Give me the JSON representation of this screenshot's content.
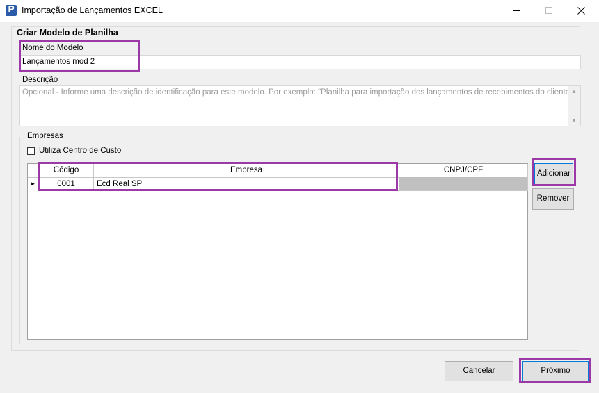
{
  "window": {
    "title": "Importação de Lançamentos EXCEL",
    "icon_letter": "P",
    "minimize_icon": "minimize-icon",
    "maximize_icon": "maximize-icon",
    "close_icon": "close-icon"
  },
  "form": {
    "section_title": "Criar Modelo de Planilha",
    "model_name_label": "Nome do Modelo",
    "model_name_value": "Lançamentos mod 2",
    "description_label": "Descrição",
    "description_placeholder": "Opcional - Informe uma descrição de identificação para este modelo. Por exemplo: \"Planilha para importação dos lançamentos de recebimentos do cliente ALPHA X."
  },
  "companies": {
    "group_title": "Empresas",
    "cost_center_label": "Utiliza Centro de Custo",
    "cost_center_checked": false,
    "columns": [
      "Código",
      "Empresa",
      "CNPJ/CPF"
    ],
    "rows": [
      {
        "codigo": "0001",
        "empresa": "Ecd Real SP",
        "cnpj": ""
      }
    ],
    "add_button": "Adicionar",
    "remove_button": "Remover"
  },
  "footer": {
    "cancel_button": "Cancelar",
    "next_button": "Próximo"
  },
  "colors": {
    "highlight": "#9b3aa6",
    "default_button_border": "#0078d7"
  }
}
